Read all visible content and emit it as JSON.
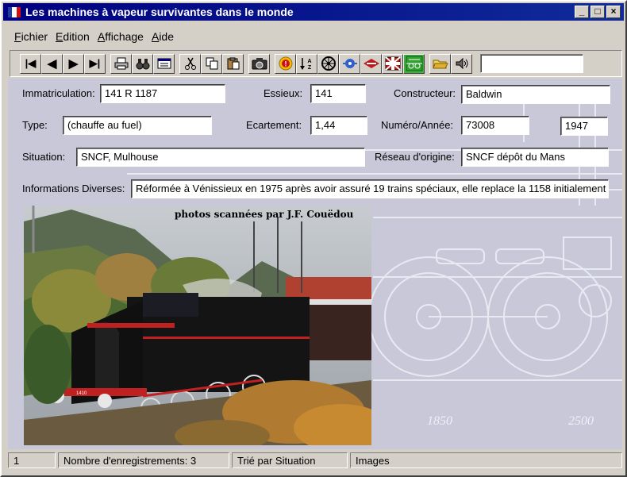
{
  "window": {
    "title": "Les machines à vapeur survivantes dans le monde",
    "minimize": "_",
    "maximize": "□",
    "close": "×"
  },
  "menu": {
    "items": [
      {
        "label": "Fichier",
        "accel": "F"
      },
      {
        "label": "Edition",
        "accel": "E"
      },
      {
        "label": "Affichage",
        "accel": "A"
      },
      {
        "label": "Aide",
        "accel": "A"
      }
    ]
  },
  "toolbar": {
    "nav_first": "|◀",
    "nav_prev": "◀",
    "nav_next": "▶",
    "nav_last": "▶|",
    "icons": [
      "first-record-icon",
      "previous-record-icon",
      "next-record-icon",
      "last-record-icon",
      "print-icon",
      "binoculars-icon",
      "form-view-icon",
      "cut-icon",
      "copy-icon",
      "paste-icon",
      "camera-icon",
      "info-badge-icon",
      "sort-icon",
      "wheel-icon",
      "network-icon",
      "sncf-logo-icon",
      "flag-icon",
      "blueprint-icon",
      "open-folder-icon",
      "sound-icon"
    ]
  },
  "form": {
    "immatriculation": {
      "label": "Immatriculation:",
      "value": "141 R 1187"
    },
    "essieux": {
      "label": "Essieux:",
      "value": "141"
    },
    "constructeur": {
      "label": "Constructeur:",
      "value": "Baldwin"
    },
    "type": {
      "label": "Type:",
      "value": "(chauffe au fuel)"
    },
    "ecartement": {
      "label": "Ecartement:",
      "value": "1,44"
    },
    "numero_annee": {
      "label": "Numéro/Année:",
      "value": "73008",
      "year": "1947"
    },
    "situation": {
      "label": "Situation:",
      "value": "SNCF, Mulhouse"
    },
    "reseau": {
      "label": "Réseau d'origine:",
      "value": "SNCF dépôt du Mans"
    },
    "infos": {
      "label": "Informations Diverses:",
      "value": "Réformée à Vénissieux en 1975 après avoir assuré 19 trains spéciaux, elle replace la 1158 initialement"
    }
  },
  "photo": {
    "caption": "photos scannées par J.F. Couëdou",
    "loco_number": "1410"
  },
  "blueprint": {
    "dim1": "1850",
    "dim2": "2500"
  },
  "status": {
    "record": "1",
    "count": "Nombre d'enregistrements:  3",
    "sort": "Trié par Situation",
    "mode": "Images"
  }
}
